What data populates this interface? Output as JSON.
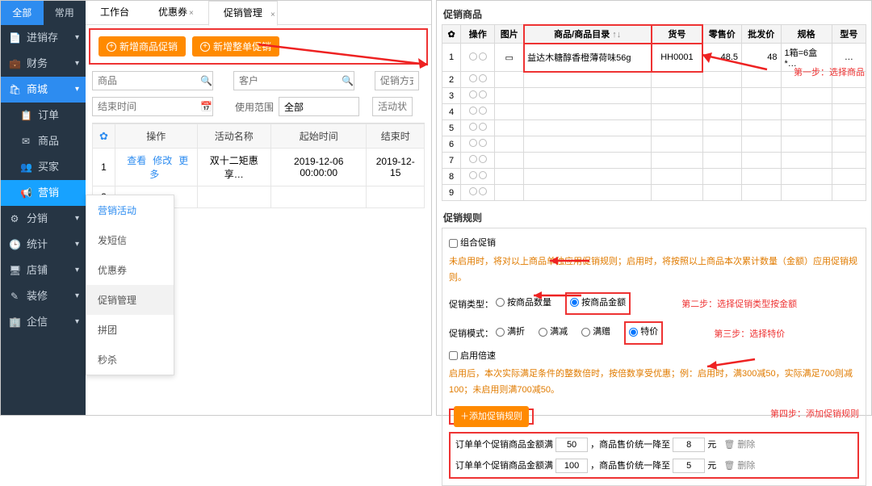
{
  "sidebar": {
    "toptabs": {
      "all": "全部",
      "common": "常用"
    },
    "items": [
      {
        "icon": "📄",
        "label": "进销存"
      },
      {
        "icon": "💼",
        "label": "财务"
      },
      {
        "icon": "🛍",
        "label": "商城",
        "active": true
      },
      {
        "icon": "📋",
        "label": "订单",
        "sub": true
      },
      {
        "icon": "✉",
        "label": "商品",
        "sub": true
      },
      {
        "icon": "👥",
        "label": "买家",
        "sub": true
      },
      {
        "icon": "📢",
        "label": "营销",
        "sub": true,
        "sel": true
      },
      {
        "icon": "⚙",
        "label": "分销"
      },
      {
        "icon": "🕒",
        "label": "统计"
      },
      {
        "icon": "🖥",
        "label": "店铺"
      },
      {
        "icon": "✎",
        "label": "装修"
      },
      {
        "icon": "🏢",
        "label": "企信"
      }
    ]
  },
  "tabs": {
    "workbench": "工作台",
    "coupon": "优惠券",
    "promo": "促销管理"
  },
  "toolbar": {
    "addProduct": "新增商品促销",
    "addOrder": "新增整单促销"
  },
  "filters": {
    "productPH": "商品",
    "customerPH": "客户",
    "endtimePH": "结束时间",
    "scopeLbl": "使用范围",
    "scopeAll": "全部",
    "methodPH": "促销方式",
    "statusPH": "活动状"
  },
  "grid": {
    "op": "操作",
    "name": "活动名称",
    "start": "起始时间",
    "end": "结束时",
    "rows": [
      {
        "i": "1",
        "ops": [
          "查看",
          "修改",
          "更多"
        ],
        "name": "双十二矩惠享…",
        "start": "2019-12-06 00:00:00",
        "end": "2019-12-15"
      },
      {
        "i": "2"
      }
    ]
  },
  "popover": [
    "营销活动",
    "发短信",
    "优惠券",
    "促销管理",
    "拼团",
    "秒杀"
  ],
  "rightTop": {
    "title": "促销商品",
    "headers": {
      "gear": "✿",
      "op": "操作",
      "pic": "图片",
      "name": "商品/商品目录",
      "sort": "↑↓",
      "sku": "货号",
      "retail": "零售价",
      "whole": "批发价",
      "spec": "规格",
      "model": "型号"
    },
    "row": {
      "name": "益达木糖醇香橙薄荷味56g",
      "sku": "HH0001",
      "retail": "48.5",
      "whole": "48",
      "spec": "1箱=6盒*…",
      "model": "…"
    },
    "step": "第一步：选择商品"
  },
  "rules": {
    "title": "促销规则",
    "combo": "组合促销",
    "comboHint": "未启用时，将对以上商品单独应用促销规则；启用时，将按照以上商品本次累计数量（金额）应用促销规则。",
    "typeLbl": "促销类型：",
    "byQty": "按商品数量",
    "byAmt": "按商品金额",
    "step2": "第二步：选择促销类型按金额",
    "modeLbl": "促销模式：",
    "modes": [
      "满折",
      "满减",
      "满赠",
      "特价"
    ],
    "step3": "第三步：选择特价",
    "multLbl": "启用倍速",
    "multHint": "启用后，本次实际满足条件的整数倍时，按倍数享受优惠；例：启用时，满300减50，实际满足700则减100；未启用则满700减50。",
    "addRule": "添加促销规则",
    "step4": "第四步：添加促销规则",
    "ruleLine": {
      "p1": "订单单个促销商品金额满",
      "p2": "，商品售价统一降至",
      "unit": "元",
      "del": "删除"
    },
    "vals": [
      {
        "a": "50",
        "b": "8"
      },
      {
        "a": "100",
        "b": "5"
      }
    ]
  }
}
